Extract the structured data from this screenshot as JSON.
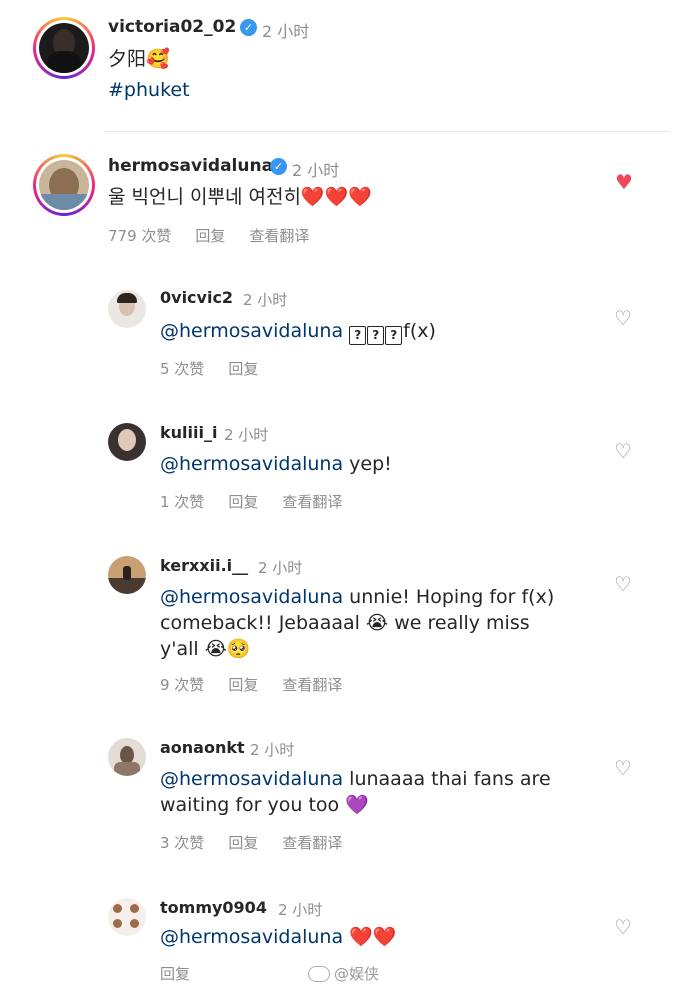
{
  "post": {
    "username": "victoria02_02",
    "time": "2 小时",
    "caption": "夕阳",
    "caption_emoji": "🥰",
    "hashtag": "#phuket"
  },
  "comments": [
    {
      "username": "hermosavidaluna",
      "verified": true,
      "time": "2 小时",
      "text": "울 빅언니 이뿌네 여전히",
      "emojis": "❤️❤️❤️",
      "likes": "779 次赞",
      "reply": "回复",
      "translate": "查看翻译",
      "liked": true
    }
  ],
  "replies": [
    {
      "username": "0vicvic2",
      "time": "2 小时",
      "mention": "@hermosavidaluna",
      "text_boxes": [
        "?",
        "?",
        "?"
      ],
      "text": "f(x)",
      "likes": "5 次赞",
      "reply": "回复"
    },
    {
      "username": "kuliii_i",
      "time": "2 小时",
      "mention": "@hermosavidaluna",
      "text": "yep!",
      "likes": "1 次赞",
      "reply": "回复",
      "translate": "查看翻译"
    },
    {
      "username": "kerxxii.i__",
      "time": "2 小时",
      "mention": "@hermosavidaluna",
      "text1": "unnie! Hoping for f(x)",
      "text2": "comeback!! Jebaaaal",
      "emoji2": "😭",
      "text2b": "we really miss",
      "text3": "y'all",
      "emoji3": "😭🥺",
      "likes": "9 次赞",
      "reply": "回复",
      "translate": "查看翻译"
    },
    {
      "username": "aonaonkt",
      "time": "2 小时",
      "mention": "@hermosavidaluna",
      "text1": "lunaaaa thai fans are",
      "text2": "waiting for you too",
      "emoji2": "💜",
      "likes": "3 次赞",
      "reply": "回复",
      "translate": "查看翻译"
    },
    {
      "username": "tommy0904",
      "time": "2 小时",
      "mention": "@hermosavidaluna",
      "emojis": "❤️❤️",
      "reply": "回复"
    }
  ],
  "watermark": "@娱侠",
  "colors": {
    "heart_liked": "#ed4956",
    "mention": "#00376b",
    "verified": "#3897f0",
    "meta": "#8e8e8e"
  }
}
